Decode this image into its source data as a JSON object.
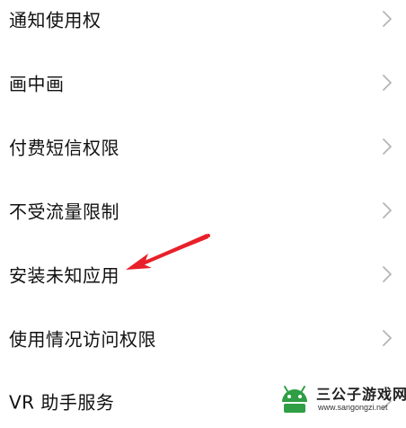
{
  "settings": {
    "items": [
      {
        "label": "通知使用权",
        "icon": "chevron-right-icon"
      },
      {
        "label": "画中画",
        "icon": "chevron-right-icon"
      },
      {
        "label": "付费短信权限",
        "icon": "chevron-right-icon"
      },
      {
        "label": "不受流量限制",
        "icon": "chevron-right-icon"
      },
      {
        "label": "安装未知应用",
        "icon": "chevron-right-icon"
      },
      {
        "label": "使用情况访问权限",
        "icon": "chevron-right-icon"
      },
      {
        "label": "VR 助手服务",
        "icon": "chevron-right-icon"
      }
    ]
  },
  "annotation": {
    "type": "arrow",
    "color": "#e8202a",
    "points_to": "安装未知应用"
  },
  "watermark": {
    "title": "三公子游戏网",
    "url": "www.sangongzi.net",
    "logo_color": "#2f9e44"
  },
  "colors": {
    "text": "#111111",
    "chevron": "#b5b5b5",
    "background": "#ffffff"
  }
}
